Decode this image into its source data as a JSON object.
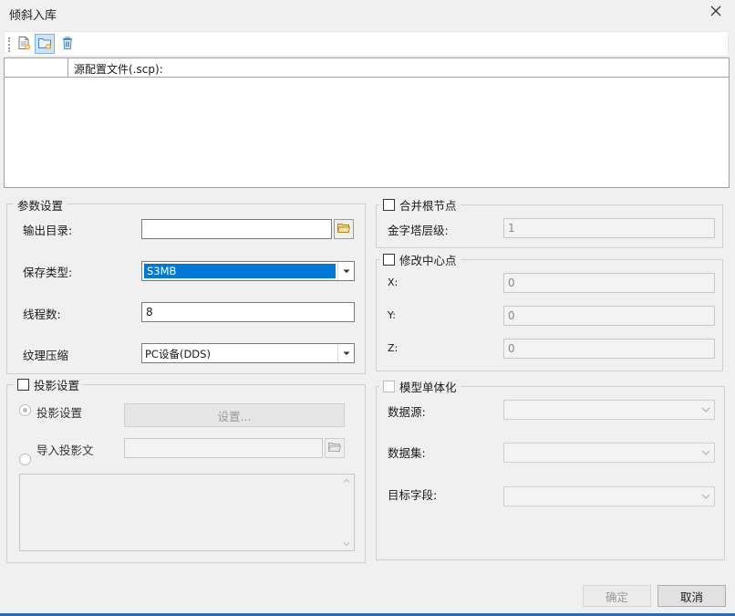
{
  "window": {
    "title": "倾斜入库"
  },
  "table": {
    "header_col2": "源配置文件(.scp):"
  },
  "params": {
    "legend": "参数设置",
    "output_dir_label": "输出目录:",
    "output_dir_value": "",
    "save_type_label": "保存类型:",
    "save_type_value": "S3MB",
    "threads_label": "线程数:",
    "threads_value": "8",
    "texture_label": "纹理压缩",
    "texture_value": "PC设备(DDS)"
  },
  "projection": {
    "legend": "投影设置",
    "radio1_label": "投影设置",
    "settings_button": "设置...",
    "radio2_label": "导入投影文",
    "file_value": ""
  },
  "merge_root": {
    "legend": "合并根节点",
    "pyramid_label": "金字塔层级:",
    "pyramid_value": "1"
  },
  "center_point": {
    "legend": "修改中心点",
    "x_label": "X:",
    "x_value": "0",
    "y_label": "Y:",
    "y_value": "0",
    "z_label": "Z:",
    "z_value": "0"
  },
  "singulation": {
    "legend": "模型单体化",
    "datasource_label": "数据源:",
    "dataset_label": "数据集:",
    "target_field_label": "目标字段:"
  },
  "buttons": {
    "ok": "确定",
    "cancel": "取消"
  },
  "colors": {
    "selection": "#0078d7",
    "background": "#f0f0f0",
    "accent_bottom": "#2b6cb0"
  },
  "icons": {
    "close": "close-icon",
    "new": "new-file-icon",
    "add_folder": "add-folder-icon",
    "delete": "delete-icon",
    "browse": "open-folder-icon"
  }
}
